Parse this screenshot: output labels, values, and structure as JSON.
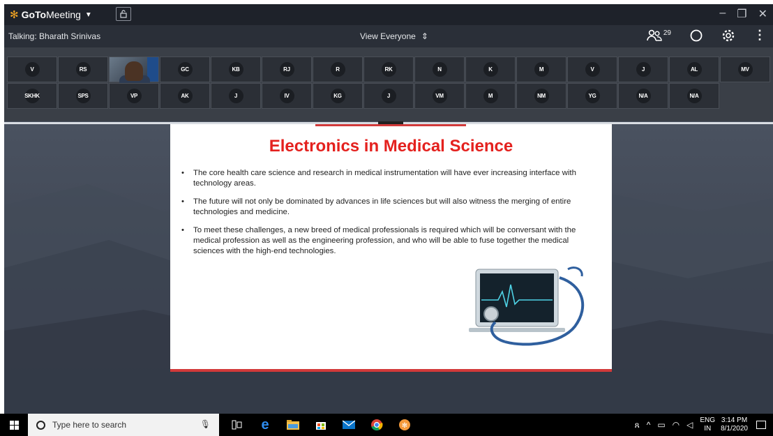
{
  "app": {
    "name_bold": "GoTo",
    "name_rest": "Meeting",
    "accent": "#f5a623"
  },
  "window_controls": [
    "–",
    "❐",
    "✕"
  ],
  "infobar": {
    "talking": "Talking: Bharath Srinivas",
    "view": "View Everyone",
    "attendee_count": "29"
  },
  "attendees": [
    "V",
    "RS",
    "",
    "GC",
    "KB",
    "RJ",
    "R",
    "RK",
    "N",
    "K",
    "M",
    "V",
    "J",
    "AL",
    "MV",
    "SKHK",
    "SPS",
    "VP",
    "AK",
    "J",
    "IV",
    "KG",
    "J",
    "VM",
    "M",
    "NM",
    "YG",
    "N/A",
    "N/A"
  ],
  "slide": {
    "title": "Electronics in Medical Science",
    "title_color": "#e4211e",
    "bullets": [
      "The core health care science and research in medical instrumentation will have ever increasing interface with technology areas.",
      "The future will not only be  dominated by advances in life sciences but will also witness the merging of entire  technologies and medicine.",
      "To meet these challenges, a new breed of  medical professionals is required which  will be conversant with the medical  profession as well as the engineering profession, and who will be able to fuse together the medical sciences with the  high-end  technologies."
    ]
  },
  "taskbar": {
    "search_placeholder": "Type here to search",
    "apps": [
      "task-view-icon",
      "edge-icon",
      "file-explorer-icon",
      "store-icon",
      "mail-icon",
      "chrome-icon",
      "app-icon"
    ],
    "lang_top": "ENG",
    "lang_bottom": "IN",
    "time": "3:14 PM",
    "date": "8/1/2020"
  }
}
